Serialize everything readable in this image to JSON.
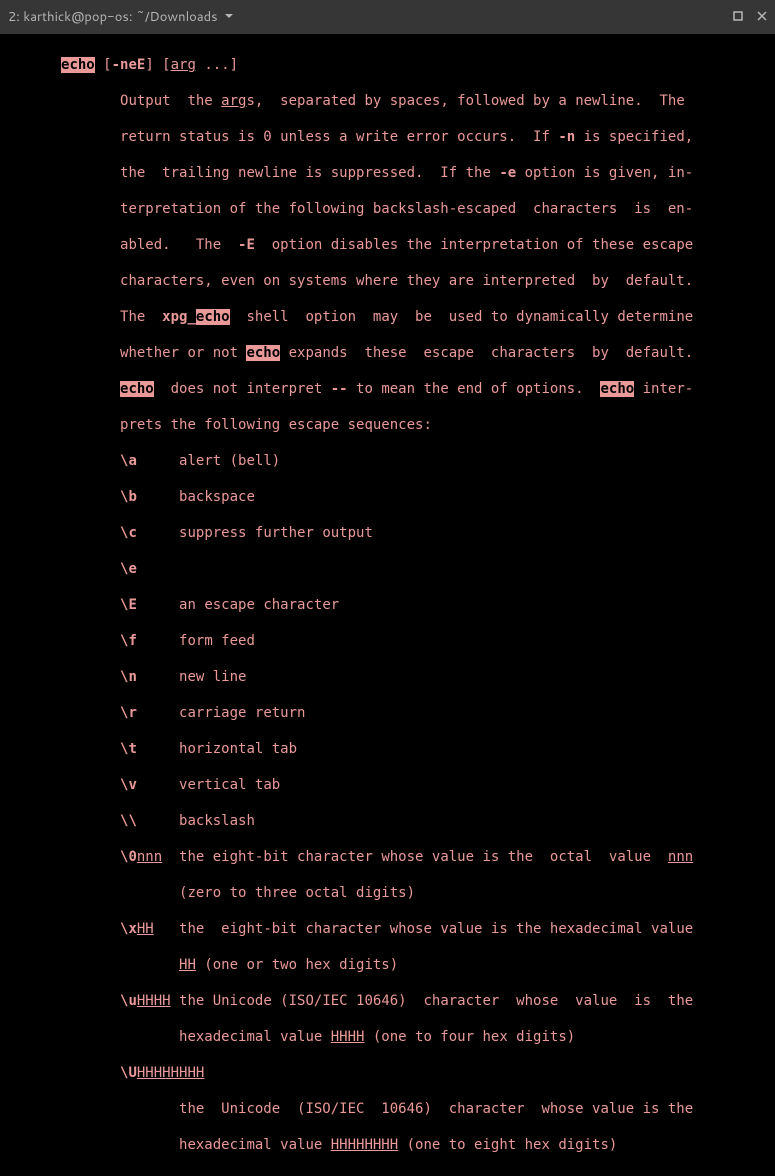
{
  "titlebar": {
    "title": "2: karthick@pop-os: ~/Downloads"
  },
  "cmd": "echo",
  "flags": "-neE",
  "arg_label": "arg",
  "ellipsis": " ...]",
  "desc": {
    "l1a": "Output  the ",
    "l1_arg": "arg",
    "l1b": "s,  separated by spaces, followed by a newline.  The",
    "l2a": "return status is 0 unless a write error occurs.  If ",
    "l2_n": "-n",
    "l2b": " is specified,",
    "l3a": "the  trailing newline is suppressed.  If the ",
    "l3_e": "-e",
    "l3b": " option is given, in-",
    "l4": "terpretation of the following backslash-escaped  characters  is  en-",
    "l5a": "abled.   The  ",
    "l5_E": "-E",
    "l5b": "  option disables the interpretation of these escape",
    "l6": "characters, even on systems where they are interpreted  by  default.",
    "l7a": "The  ",
    "l7_xpg": "xpg_",
    "l7_echo": "echo",
    "l7b": "  shell  option  may  be  used to dynamically determine",
    "l8a": "whether or not ",
    "l8_echo": "echo",
    "l8b": " expands  these  escape  characters  by  default.",
    "l9_echo": "echo",
    "l9a": "  does not interpret ",
    "l9_dd": "--",
    "l9b": " to mean the end of options.  ",
    "l9_echo2": "echo",
    "l9c": " inter-",
    "l10": "prets the following escape sequences:"
  },
  "seq": {
    "a": {
      "k": "\\a",
      "v": "alert (bell)"
    },
    "b": {
      "k": "\\b",
      "v": "backspace"
    },
    "c": {
      "k": "\\c",
      "v": "suppress further output"
    },
    "e": {
      "k": "\\e",
      "v": ""
    },
    "E": {
      "k": "\\E",
      "v": "an escape character"
    },
    "f": {
      "k": "\\f",
      "v": "form feed"
    },
    "n": {
      "k": "\\n",
      "v": "new line"
    },
    "r": {
      "k": "\\r",
      "v": "carriage return"
    },
    "t": {
      "k": "\\t",
      "v": "horizontal tab"
    },
    "v": {
      "k": "\\v",
      "v": "vertical tab"
    },
    "bs": {
      "k": "\\\\",
      "v": "backslash"
    },
    "o0": {
      "k": "\\0",
      "arg": "nnn",
      "v1": "the eight-bit character whose value is the  octal  value  ",
      "arg2": "nnn",
      "v2": "(zero to three octal digits)"
    },
    "xH": {
      "k": "\\x",
      "arg": "HH",
      "v1": "the  eight-bit character whose value is the hexadecimal value",
      "arg2": "HH",
      "v2": " (one or two hex digits)"
    },
    "uH": {
      "k": "\\u",
      "arg": "HHHH",
      "v1": "the Unicode (ISO/IEC 10646)  character  whose  value  is  the",
      "v2a": "hexadecimal value ",
      "arg2": "HHHH",
      "v2b": " (one to four hex digits)"
    },
    "UH": {
      "k": "\\U",
      "arg": "HHHHHHHH",
      "v1": "the  Unicode  (ISO/IEC  10646)  character  whose value is the",
      "v2a": "hexadecimal value ",
      "arg2": "HHHHHHHH",
      "v2b": " (one to eight hex digits)"
    }
  }
}
